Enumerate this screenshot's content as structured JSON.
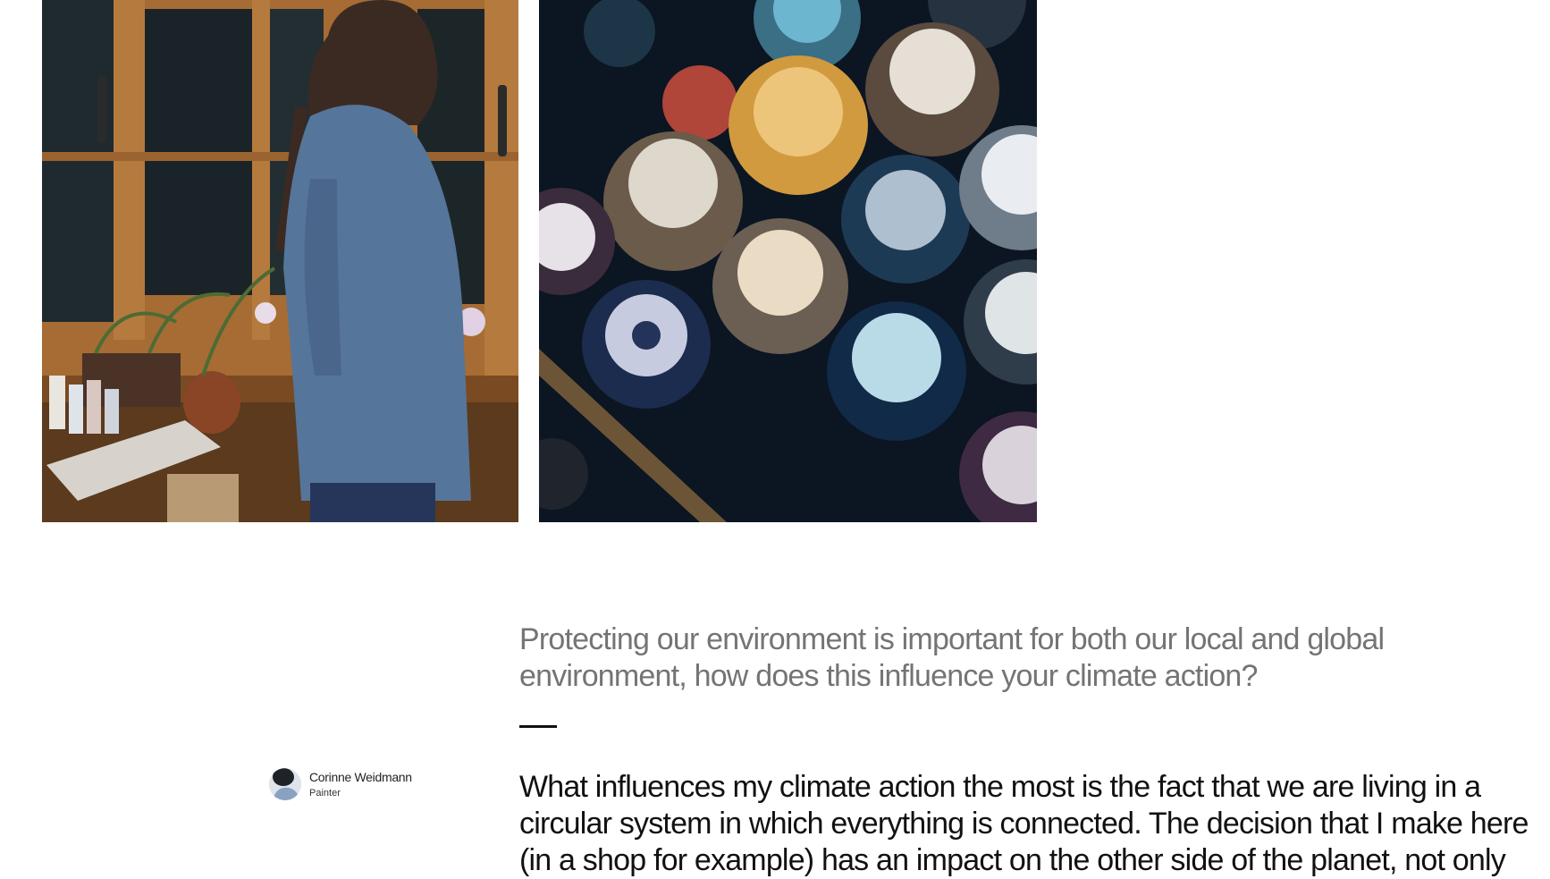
{
  "images": {
    "left_alt": "Painter standing by a window in her studio",
    "right_alt": "Overhead view of paint bottles"
  },
  "interview": {
    "question": "Protecting our environment is important for both our local and global environment, how does this influence your climate action?",
    "answer": "What influences my climate action the most is the fact that we are living in a circular system in which everything is connected. The decision that I make here (in a shop for example) has an impact on the other side of the planet, not only"
  },
  "author": {
    "name": "Corinne Weidmann",
    "role": "Painter"
  }
}
